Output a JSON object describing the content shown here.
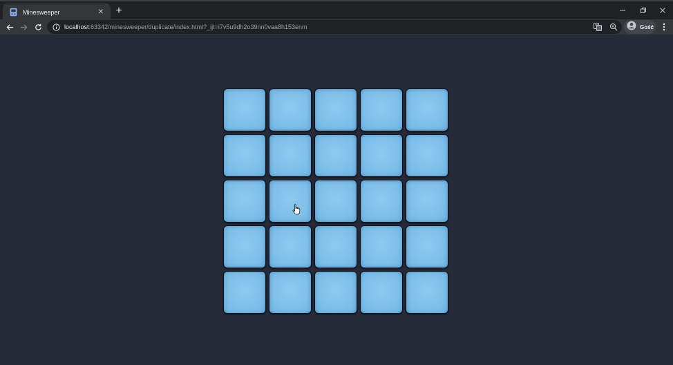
{
  "browser": {
    "tab": {
      "title": "Minesweeper",
      "favicon": "game-controller-icon",
      "close_glyph": "✕"
    },
    "new_tab_glyph": "+",
    "url": {
      "host": "localhost",
      "rest": ":63342/minesweeper/duplicate/index.html?_ijt=i7v5u9dh2o39nn0vaa8h153enm"
    },
    "profile": {
      "label": "Gość",
      "icon": "person-icon"
    },
    "colors": {
      "tabstrip": "#202124",
      "toolbar": "#35363a",
      "accent": "#8ab4f8"
    }
  },
  "game": {
    "rows": 5,
    "cols": 5,
    "cells": [
      [
        {
          "state": "hidden"
        },
        {
          "state": "hidden"
        },
        {
          "state": "hidden"
        },
        {
          "state": "hidden"
        },
        {
          "state": "hidden"
        }
      ],
      [
        {
          "state": "hidden"
        },
        {
          "state": "hidden"
        },
        {
          "state": "hidden"
        },
        {
          "state": "hidden"
        },
        {
          "state": "hidden"
        }
      ],
      [
        {
          "state": "hidden"
        },
        {
          "state": "hidden"
        },
        {
          "state": "hidden"
        },
        {
          "state": "hidden"
        },
        {
          "state": "hidden"
        }
      ],
      [
        {
          "state": "hidden"
        },
        {
          "state": "hidden"
        },
        {
          "state": "hidden"
        },
        {
          "state": "hidden"
        },
        {
          "state": "hidden"
        }
      ],
      [
        {
          "state": "hidden"
        },
        {
          "state": "hidden"
        },
        {
          "state": "hidden"
        },
        {
          "state": "hidden"
        },
        {
          "state": "hidden"
        }
      ]
    ],
    "colors": {
      "page_background": "#262b3a",
      "cell_fill": "#80c0ea",
      "cell_border": "#0f1320"
    }
  }
}
